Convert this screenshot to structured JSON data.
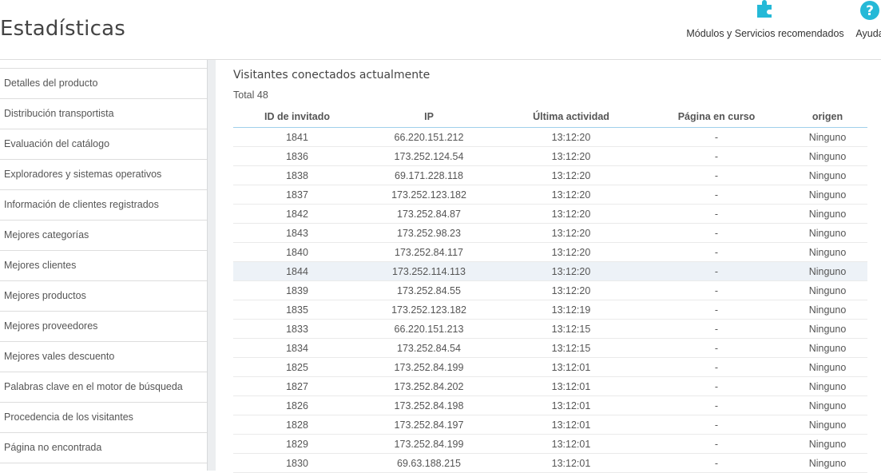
{
  "page": {
    "title": "Estadísticas"
  },
  "toolbar": {
    "modules_label": "Módulos y Servicios recomendados",
    "help_label": "Ayuda",
    "accent_color": "#25b9d7"
  },
  "sidebar": {
    "items": [
      "Detalles del producto",
      "Distribución transportista",
      "Evaluación del catálogo",
      "Exploradores y sistemas operativos",
      "Información de clientes registrados",
      "Mejores categorías",
      "Mejores clientes",
      "Mejores productos",
      "Mejores proveedores",
      "Mejores vales descuento",
      "Palabras clave en el motor de búsqueda",
      "Procedencia de los visitantes",
      "Página no encontrada"
    ]
  },
  "panel": {
    "title": "Visitantes conectados actualmente",
    "total": "Total 48",
    "columns": [
      "ID de invitado",
      "IP",
      "Última actividad",
      "Página en curso",
      "origen"
    ],
    "rows": [
      [
        "1841",
        "66.220.151.212",
        "13:12:20",
        "-",
        "Ninguno"
      ],
      [
        "1836",
        "173.252.124.54",
        "13:12:20",
        "-",
        "Ninguno"
      ],
      [
        "1838",
        "69.171.228.118",
        "13:12:20",
        "-",
        "Ninguno"
      ],
      [
        "1837",
        "173.252.123.182",
        "13:12:20",
        "-",
        "Ninguno"
      ],
      [
        "1842",
        "173.252.84.87",
        "13:12:20",
        "-",
        "Ninguno"
      ],
      [
        "1843",
        "173.252.98.23",
        "13:12:20",
        "-",
        "Ninguno"
      ],
      [
        "1840",
        "173.252.84.117",
        "13:12:20",
        "-",
        "Ninguno"
      ],
      [
        "1844",
        "173.252.114.113",
        "13:12:20",
        "-",
        "Ninguno"
      ],
      [
        "1839",
        "173.252.84.55",
        "13:12:20",
        "-",
        "Ninguno"
      ],
      [
        "1835",
        "173.252.123.182",
        "13:12:19",
        "-",
        "Ninguno"
      ],
      [
        "1833",
        "66.220.151.213",
        "13:12:15",
        "-",
        "Ninguno"
      ],
      [
        "1834",
        "173.252.84.54",
        "13:12:15",
        "-",
        "Ninguno"
      ],
      [
        "1825",
        "173.252.84.199",
        "13:12:01",
        "-",
        "Ninguno"
      ],
      [
        "1827",
        "173.252.84.202",
        "13:12:01",
        "-",
        "Ninguno"
      ],
      [
        "1826",
        "173.252.84.198",
        "13:12:01",
        "-",
        "Ninguno"
      ],
      [
        "1828",
        "173.252.84.197",
        "13:12:01",
        "-",
        "Ninguno"
      ],
      [
        "1829",
        "173.252.84.199",
        "13:12:01",
        "-",
        "Ninguno"
      ],
      [
        "1830",
        "69.63.188.215",
        "13:12:01",
        "-",
        "Ninguno"
      ]
    ],
    "highlighted_row": 7
  }
}
